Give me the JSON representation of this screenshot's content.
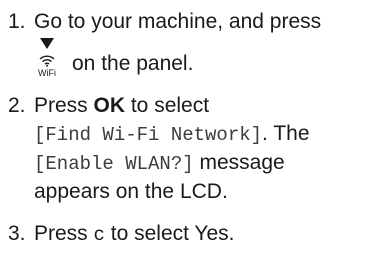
{
  "steps": [
    {
      "number": "1.",
      "line1": "Go to your machine, and press",
      "wifi_key_label": "WiFi",
      "line2": "on the panel."
    },
    {
      "number": "2.",
      "press": "Press ",
      "ok_key": "OK",
      "to_select": " to select",
      "menu_option": "[Find Wi-Fi Network]",
      "the": ". The",
      "message": "[Enable WLAN?]",
      "message_rest": " message",
      "appears": "appears on the LCD."
    },
    {
      "number": "3.",
      "press": "Press ",
      "key": "c",
      "rest": " to select Yes."
    }
  ],
  "icons": {
    "wifi_key": "wifi-key-icon"
  }
}
